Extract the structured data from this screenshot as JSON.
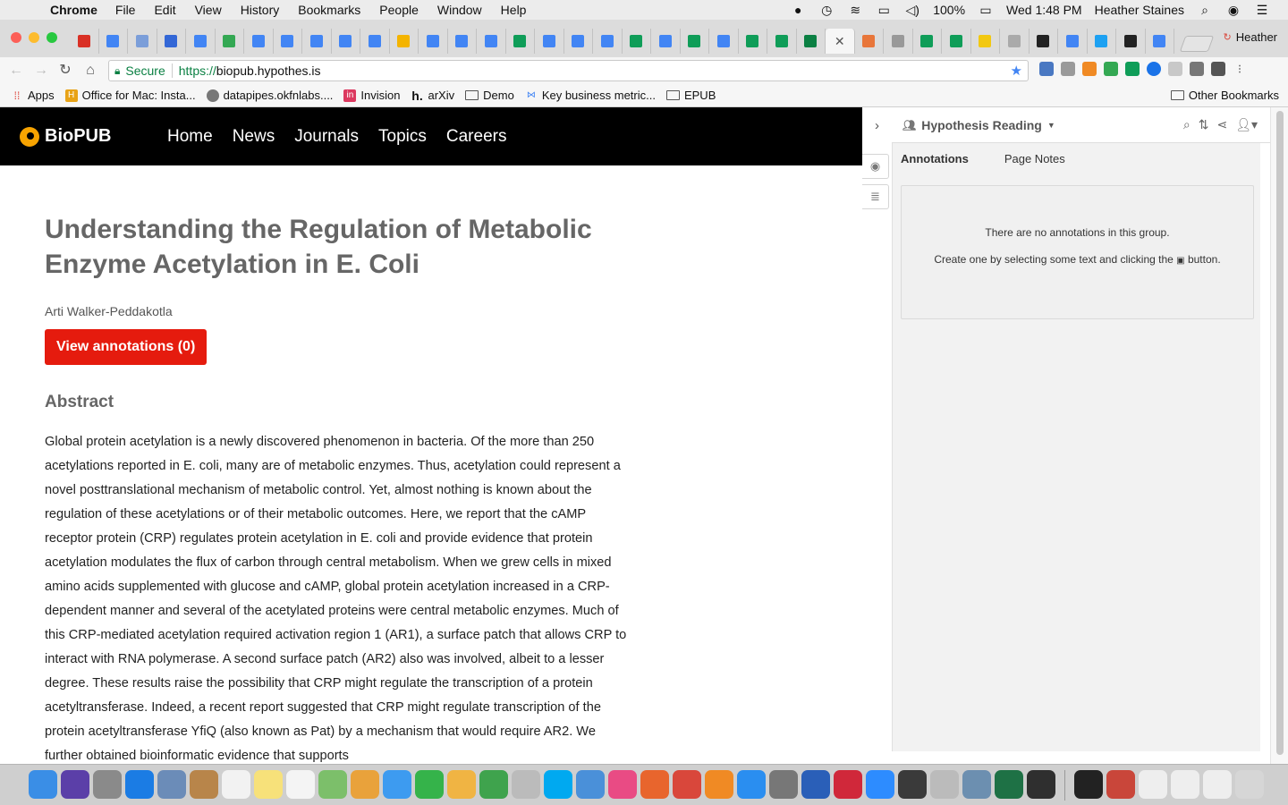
{
  "menubar": {
    "app_name": "Chrome",
    "items": [
      "File",
      "Edit",
      "View",
      "History",
      "Bookmarks",
      "People",
      "Window",
      "Help"
    ],
    "battery": "100%",
    "clock": "Wed 1:48 PM",
    "user": "Heather Staines"
  },
  "tabs": {
    "profile": "Heather",
    "favicons": [
      {
        "icon": "gmail-icon",
        "color": "#d93025"
      },
      {
        "icon": "docs-icon",
        "color": "#4285f4"
      },
      {
        "icon": "slides-icon",
        "color": "#7b9ed9"
      },
      {
        "icon": "calendar-icon",
        "color": "#3367d6"
      },
      {
        "icon": "docs-icon",
        "color": "#4285f4"
      },
      {
        "icon": "drive-icon",
        "color": "#34a853"
      },
      {
        "icon": "docs-icon",
        "color": "#4285f4"
      },
      {
        "icon": "docs-icon",
        "color": "#4285f4"
      },
      {
        "icon": "docs-icon",
        "color": "#4285f4"
      },
      {
        "icon": "docs-icon",
        "color": "#4285f4"
      },
      {
        "icon": "docs-icon",
        "color": "#4285f4"
      },
      {
        "icon": "slides-icon",
        "color": "#f4b400"
      },
      {
        "icon": "docs-icon",
        "color": "#4285f4"
      },
      {
        "icon": "docs-icon",
        "color": "#4285f4"
      },
      {
        "icon": "docs-icon",
        "color": "#4285f4"
      },
      {
        "icon": "sheets-icon",
        "color": "#0f9d58"
      },
      {
        "icon": "docs-icon",
        "color": "#4285f4"
      },
      {
        "icon": "docs-icon",
        "color": "#4285f4"
      },
      {
        "icon": "docs-icon",
        "color": "#4285f4"
      },
      {
        "icon": "sheets-icon",
        "color": "#0f9d58"
      },
      {
        "icon": "docs-icon",
        "color": "#4285f4"
      },
      {
        "icon": "sheets-icon",
        "color": "#0f9d58"
      },
      {
        "icon": "docs-icon",
        "color": "#4285f4"
      },
      {
        "icon": "sheets-icon",
        "color": "#0f9d58"
      },
      {
        "icon": "sheets-icon",
        "color": "#0f9d58"
      },
      {
        "icon": "hypothesis-icon",
        "color": "#0b8043"
      }
    ],
    "active_close": "✕",
    "favicons_after": [
      {
        "icon": "w3-icon",
        "color": "#e8763a"
      },
      {
        "icon": "file-icon",
        "color": "#999999"
      },
      {
        "icon": "sheets-icon",
        "color": "#0f9d58"
      },
      {
        "icon": "sheets-icon",
        "color": "#0f9d58"
      },
      {
        "icon": "mendeley-icon",
        "color": "#f2c811"
      },
      {
        "icon": "hypothesis-icon",
        "color": "#aaaaaa"
      },
      {
        "icon": "hypothesis-icon",
        "color": "#222222"
      },
      {
        "icon": "docs-icon",
        "color": "#4285f4"
      },
      {
        "icon": "twitter-icon",
        "color": "#1da1f2"
      },
      {
        "icon": "hypothesis-icon",
        "color": "#222222"
      },
      {
        "icon": "docs-icon",
        "color": "#4285f4"
      }
    ]
  },
  "toolbar": {
    "secure_label": "Secure",
    "url_scheme": "https://",
    "url_host": "biopub.hypothes.is"
  },
  "bookmarks": {
    "items": [
      {
        "label": "Apps",
        "icon": "apps-grid-icon"
      },
      {
        "label": "Office for Mac: Insta...",
        "icon": "office-icon"
      },
      {
        "label": "datapipes.okfnlabs....",
        "icon": "datapipes-icon"
      },
      {
        "label": "Invision",
        "icon": "invision-icon"
      },
      {
        "label": "arXiv",
        "icon": "hypothesis-icon"
      },
      {
        "label": "Demo",
        "icon": "folder-icon"
      },
      {
        "label": "Key business metric...",
        "icon": "metrics-icon"
      },
      {
        "label": "EPUB",
        "icon": "folder-icon"
      }
    ],
    "other": "Other Bookmarks"
  },
  "site": {
    "logo": "BioPUB",
    "nav": [
      "Home",
      "News",
      "Journals",
      "Topics",
      "Careers"
    ],
    "article": {
      "title": "Understanding the Regulation of Metabolic Enzyme Acetylation in E. Coli",
      "author": "Arti Walker-Peddakotla",
      "view_button": "View annotations (0)",
      "abstract_heading": "Abstract",
      "abstract": "Global protein acetylation is a newly discovered phenomenon in bacteria. Of the more than 250 acetylations reported in E. coli, many are of metabolic enzymes. Thus, acetylation could represent a novel posttranslational mechanism of metabolic control. Yet, almost nothing is known about the regulation of these acetylations or of their metabolic outcomes. Here, we report that the cAMP receptor protein (CRP) regulates protein acetylation in E. coli and provide evidence that protein acetylation modulates the flux of carbon through central metabolism. When we grew cells in mixed amino acids supplemented with glucose and cAMP, global protein acetylation increased in a CRP-dependent manner and several of the acetylated proteins were central metabolic enzymes. Much of this CRP-mediated acetylation required activation region 1 (AR1), a surface patch that allows CRP to interact with RNA polymerase. A second surface patch (AR2) also was involved, albeit to a lesser degree. These results raise the possibility that CRP might regulate the transcription of a protein acetyltransferase. Indeed, a recent report suggested that CRP might regulate transcription of the protein acetyltransferase YfiQ (also known as Pat) by a mechanism that would require AR2. We further obtained bioinformatic evidence that supports"
    }
  },
  "sidebar": {
    "group_name": "Hypothesis Reading",
    "tabs": [
      "Annotations",
      "Page Notes"
    ],
    "empty_line1": "There are no annotations in this group.",
    "empty_line2_before": "Create one by selecting some text and clicking the",
    "empty_line2_after": "button."
  },
  "dock": {
    "apps": [
      {
        "name": "finder-icon",
        "color": "#3a8ee6"
      },
      {
        "name": "siri-icon",
        "color": "#5b3fa8"
      },
      {
        "name": "launchpad-icon",
        "color": "#8a8a8a"
      },
      {
        "name": "safari-icon",
        "color": "#1b7ce4"
      },
      {
        "name": "preview-icon",
        "color": "#6b8cb8"
      },
      {
        "name": "contacts-icon",
        "color": "#b8854a"
      },
      {
        "name": "calendar-icon",
        "color": "#f2f2f2"
      },
      {
        "name": "notes-icon",
        "color": "#f7e17a"
      },
      {
        "name": "reminders-icon",
        "color": "#f4f4f4"
      },
      {
        "name": "maps-icon",
        "color": "#7cbf6a"
      },
      {
        "name": "photos-icon",
        "color": "#e9a23b"
      },
      {
        "name": "messages-icon",
        "color": "#3d9bf0"
      },
      {
        "name": "facetime-icon",
        "color": "#35b34a"
      },
      {
        "name": "sketch-icon",
        "color": "#f0b443"
      },
      {
        "name": "numbers-icon",
        "color": "#3fa34d"
      },
      {
        "name": "help-icon",
        "color": "#bbbbbb"
      },
      {
        "name": "skype-icon",
        "color": "#00a9f0"
      },
      {
        "name": "keynote-icon",
        "color": "#4a90d9"
      },
      {
        "name": "itunes-icon",
        "color": "#e94b84"
      },
      {
        "name": "firefox-icon",
        "color": "#e8652d"
      },
      {
        "name": "chrome-icon",
        "color": "#d9473b"
      },
      {
        "name": "ibooks-icon",
        "color": "#f08a24"
      },
      {
        "name": "appstore-icon",
        "color": "#2a8ef0"
      },
      {
        "name": "system-prefs-icon",
        "color": "#777777"
      },
      {
        "name": "thunderbird-icon",
        "color": "#2a5fb8"
      },
      {
        "name": "slack-icon",
        "color": "#d0283a"
      },
      {
        "name": "zoom-icon",
        "color": "#2d8cff"
      },
      {
        "name": "quicktime-icon",
        "color": "#3a3a3a"
      },
      {
        "name": "help-icon",
        "color": "#bbbbbb"
      },
      {
        "name": "mail-icon",
        "color": "#6c8fb0"
      },
      {
        "name": "excel-icon",
        "color": "#1e7145"
      },
      {
        "name": "activity-monitor-icon",
        "color": "#2f2f2f"
      }
    ],
    "others": [
      {
        "name": "terminal-icon",
        "color": "#222222"
      },
      {
        "name": "window-thumb-icon",
        "color": "#c9463a"
      },
      {
        "name": "window-thumb-icon",
        "color": "#eeeeee"
      },
      {
        "name": "window-thumb-icon",
        "color": "#eeeeee"
      },
      {
        "name": "window-thumb-icon",
        "color": "#eeeeee"
      },
      {
        "name": "trash-icon",
        "color": "#d6d6d6"
      }
    ]
  }
}
